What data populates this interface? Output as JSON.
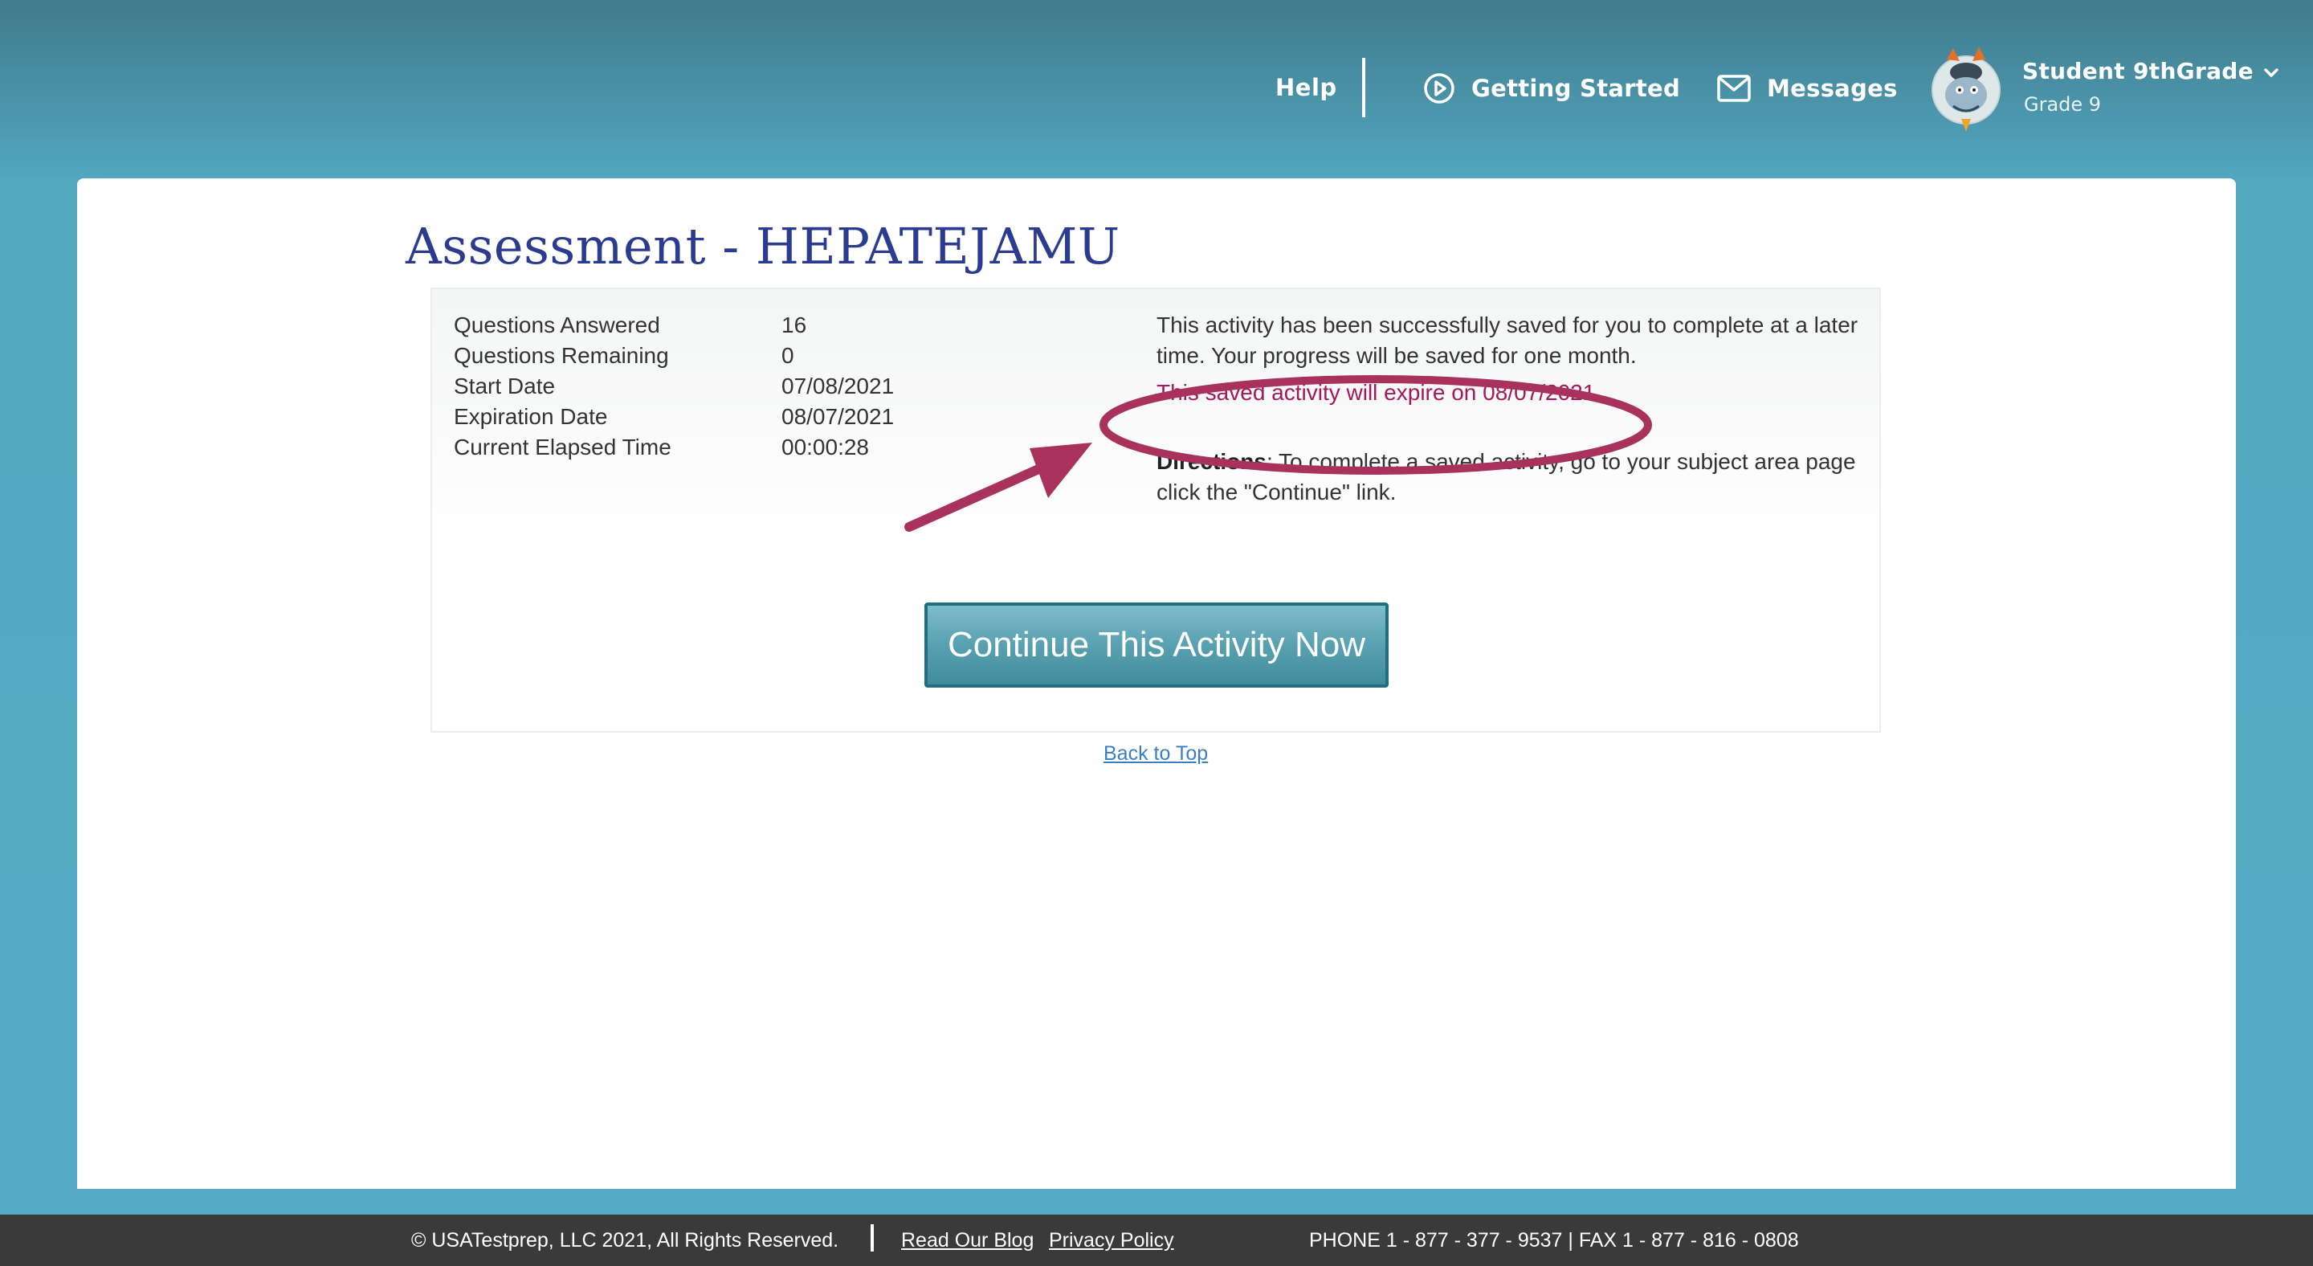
{
  "header": {
    "help": "Help",
    "getting_started": "Getting Started",
    "messages": "Messages",
    "user_name": "Student 9thGrade",
    "user_grade": "Grade 9"
  },
  "page": {
    "title": "Assessment - HEPATEJAMU"
  },
  "stats": [
    {
      "label": "Questions Answered",
      "value": "16"
    },
    {
      "label": "Questions Remaining",
      "value": "0"
    },
    {
      "label": "Start Date",
      "value": "07/08/2021"
    },
    {
      "label": "Expiration Date",
      "value": "08/07/2021"
    },
    {
      "label": "Current Elapsed Time",
      "value": "00:00:28"
    }
  ],
  "status": {
    "saved_message": "This activity has been successfully saved for you to complete at a later time. Your progress will be saved for one month.",
    "expire_message": "This saved activity will expire on 08/07/2021.",
    "directions_label": "Directions",
    "directions_text": ": To complete a saved activity, go to your subject area page click the \"Continue\" link."
  },
  "actions": {
    "continue_label": "Continue This Activity Now",
    "back_to_top": "Back to Top"
  },
  "footer": {
    "copyright": "© USATestprep, LLC 2021, All Rights Reserved.",
    "blog": "Read Our Blog",
    "privacy": "Privacy Policy",
    "contact": "PHONE 1 - 877 - 377 - 9537 | FAX 1 - 877 - 816 - 0808"
  },
  "colors": {
    "header_top": "#3f7b8c",
    "background": "#52aac4",
    "title": "#2b3b8f",
    "expire_text": "#a3195b",
    "annotation": "#a8325c",
    "button": "#5ca3b3",
    "link": "#3a7fc4",
    "footer": "#3a3a3a"
  },
  "icons": {
    "getting_started": "play-circle-icon",
    "messages": "envelope-icon",
    "user_menu": "chevron-down-icon"
  }
}
